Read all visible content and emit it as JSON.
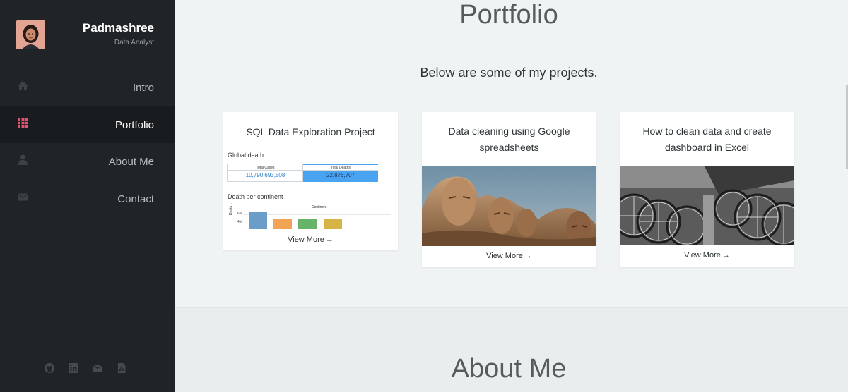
{
  "sidebar": {
    "profile": {
      "name": "Padmashree",
      "role": "Data Analyst"
    },
    "nav": [
      {
        "label": "Intro",
        "icon": "home-icon",
        "active": false
      },
      {
        "label": "Portfolio",
        "icon": "grid-icon",
        "active": true
      },
      {
        "label": "About Me",
        "icon": "user-icon",
        "active": false
      },
      {
        "label": "Contact",
        "icon": "envelope-icon",
        "active": false
      }
    ],
    "social": [
      "github-icon",
      "linkedin-icon",
      "email-icon",
      "pdf-file-icon"
    ],
    "accent_color": "#e0536f"
  },
  "portfolio": {
    "title": "Portfolio",
    "subtitle": "Below are some of my projects.",
    "view_more_label": "View More",
    "cards": [
      {
        "title": "SQL Data Exploration Project",
        "dashboard": {
          "global_death_label": "Global death",
          "total_cases_header": "Total Cases",
          "total_cases_value": "10,790,693,508",
          "total_deaths_header": "Total Deaths",
          "total_deaths_value": "22,876,707",
          "death_per_continent_label": "Death per continent",
          "continent_header": "Continent",
          "axis_label": "Death ...",
          "tick_6m": "6M",
          "tick_4m": "4M",
          "bar_colors": [
            "#6a9ec8",
            "#f2a356",
            "#66b468",
            "#d6b447"
          ]
        }
      },
      {
        "title": "Data cleaning using Google spreadsheets",
        "image": "mount-rushmore-photo"
      },
      {
        "title": "How to clean data and create dashboard in Excel",
        "image": "bicycles-photo"
      }
    ]
  },
  "about": {
    "title": "About Me"
  }
}
